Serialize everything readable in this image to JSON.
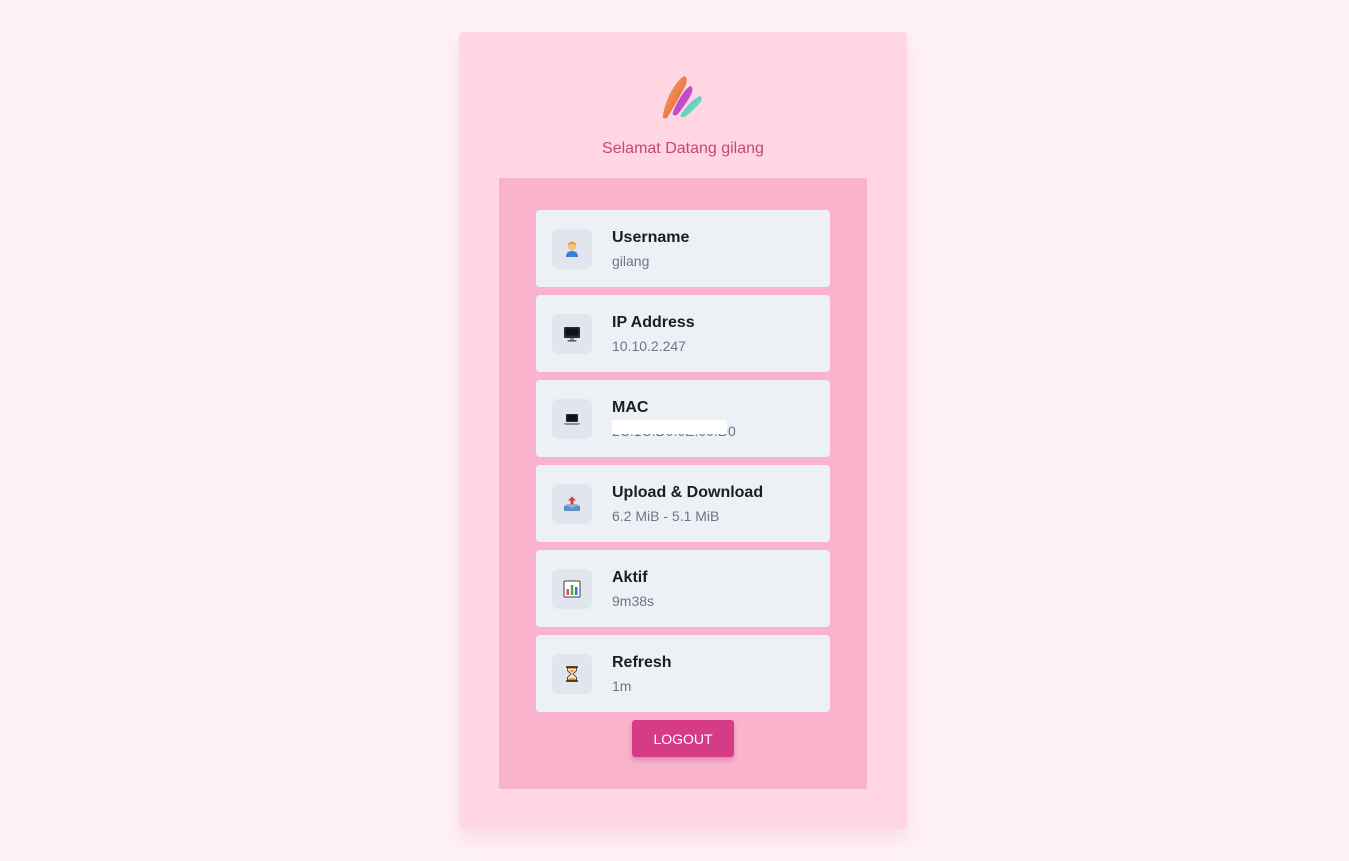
{
  "header": {
    "logo_icon": "brush-stroke-logo-icon",
    "welcome_text": "Selamat Datang gilang"
  },
  "info_items": [
    {
      "label": "Username",
      "value": "gilang",
      "icon": "person-icon"
    },
    {
      "label": "IP Address",
      "value": "10.10.2.247",
      "icon": "desktop-computer-icon"
    },
    {
      "label": "MAC",
      "value": "2C:1C:D0:0E:00:D0",
      "icon": "laptop-icon"
    },
    {
      "label": "Upload & Download",
      "value": "6.2 MiB - 5.1 MiB",
      "icon": "outbox-tray-icon"
    },
    {
      "label": "Aktif",
      "value": "9m38s",
      "icon": "bar-chart-icon"
    },
    {
      "label": "Refresh",
      "value": "1m",
      "icon": "hourglass-icon"
    }
  ],
  "actions": {
    "logout_label": "LOGOUT"
  },
  "colors": {
    "page_background": "#fff2f4",
    "card_background": "#ffd6e1",
    "panel_background": "#f9b3cc",
    "item_background": "#edf1f5",
    "accent": "#d63c86",
    "welcome_text": "#c2477f"
  }
}
